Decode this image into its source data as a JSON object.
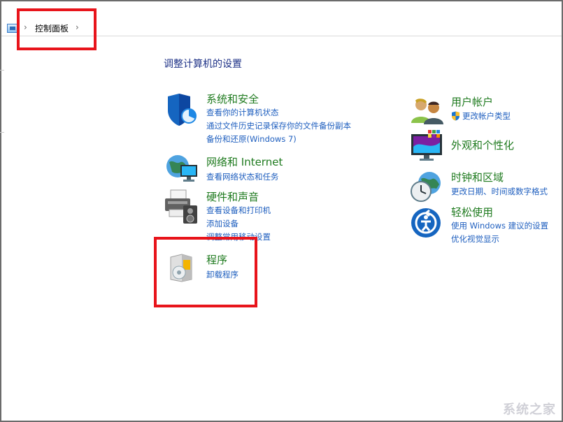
{
  "breadcrumb": {
    "root_icon": "control-panel-icon",
    "label": "控制面板"
  },
  "heading": "调整计算机的设置",
  "categories": {
    "system_security": {
      "title": "系统和安全",
      "links": [
        "查看你的计算机状态",
        "通过文件历史记录保存你的文件备份副本",
        "备份和还原(Windows 7)"
      ],
      "icon": "shield-icon"
    },
    "network": {
      "title": "网络和 Internet",
      "links": [
        "查看网络状态和任务"
      ],
      "icon": "globe-network-icon"
    },
    "hardware": {
      "title": "硬件和声音",
      "links": [
        "查看设备和打印机",
        "添加设备",
        "调整常用移动设置"
      ],
      "icon": "printer-icon"
    },
    "programs": {
      "title": "程序",
      "links": [
        "卸载程序"
      ],
      "icon": "programs-disc-icon"
    },
    "user_accounts": {
      "title": "用户帐户",
      "links": [
        "更改帐户类型"
      ],
      "icon": "users-icon",
      "link_icon": "uac-shield-icon"
    },
    "appearance": {
      "title": "外观和个性化",
      "links": [],
      "icon": "monitor-palette-icon"
    },
    "clock_region": {
      "title": "时钟和区域",
      "links": [
        "更改日期、时间或数字格式"
      ],
      "icon": "clock-globe-icon"
    },
    "ease_of_access": {
      "title": "轻松使用",
      "links": [
        "使用 Windows 建议的设置",
        "优化视觉显示"
      ],
      "icon": "ease-of-access-icon"
    }
  },
  "watermark": "系统之家",
  "colors": {
    "title_green": "#1e7a1e",
    "link_blue": "#1f5fbf",
    "heading_blue": "#1e3287",
    "highlight_red": "#e8141b"
  }
}
